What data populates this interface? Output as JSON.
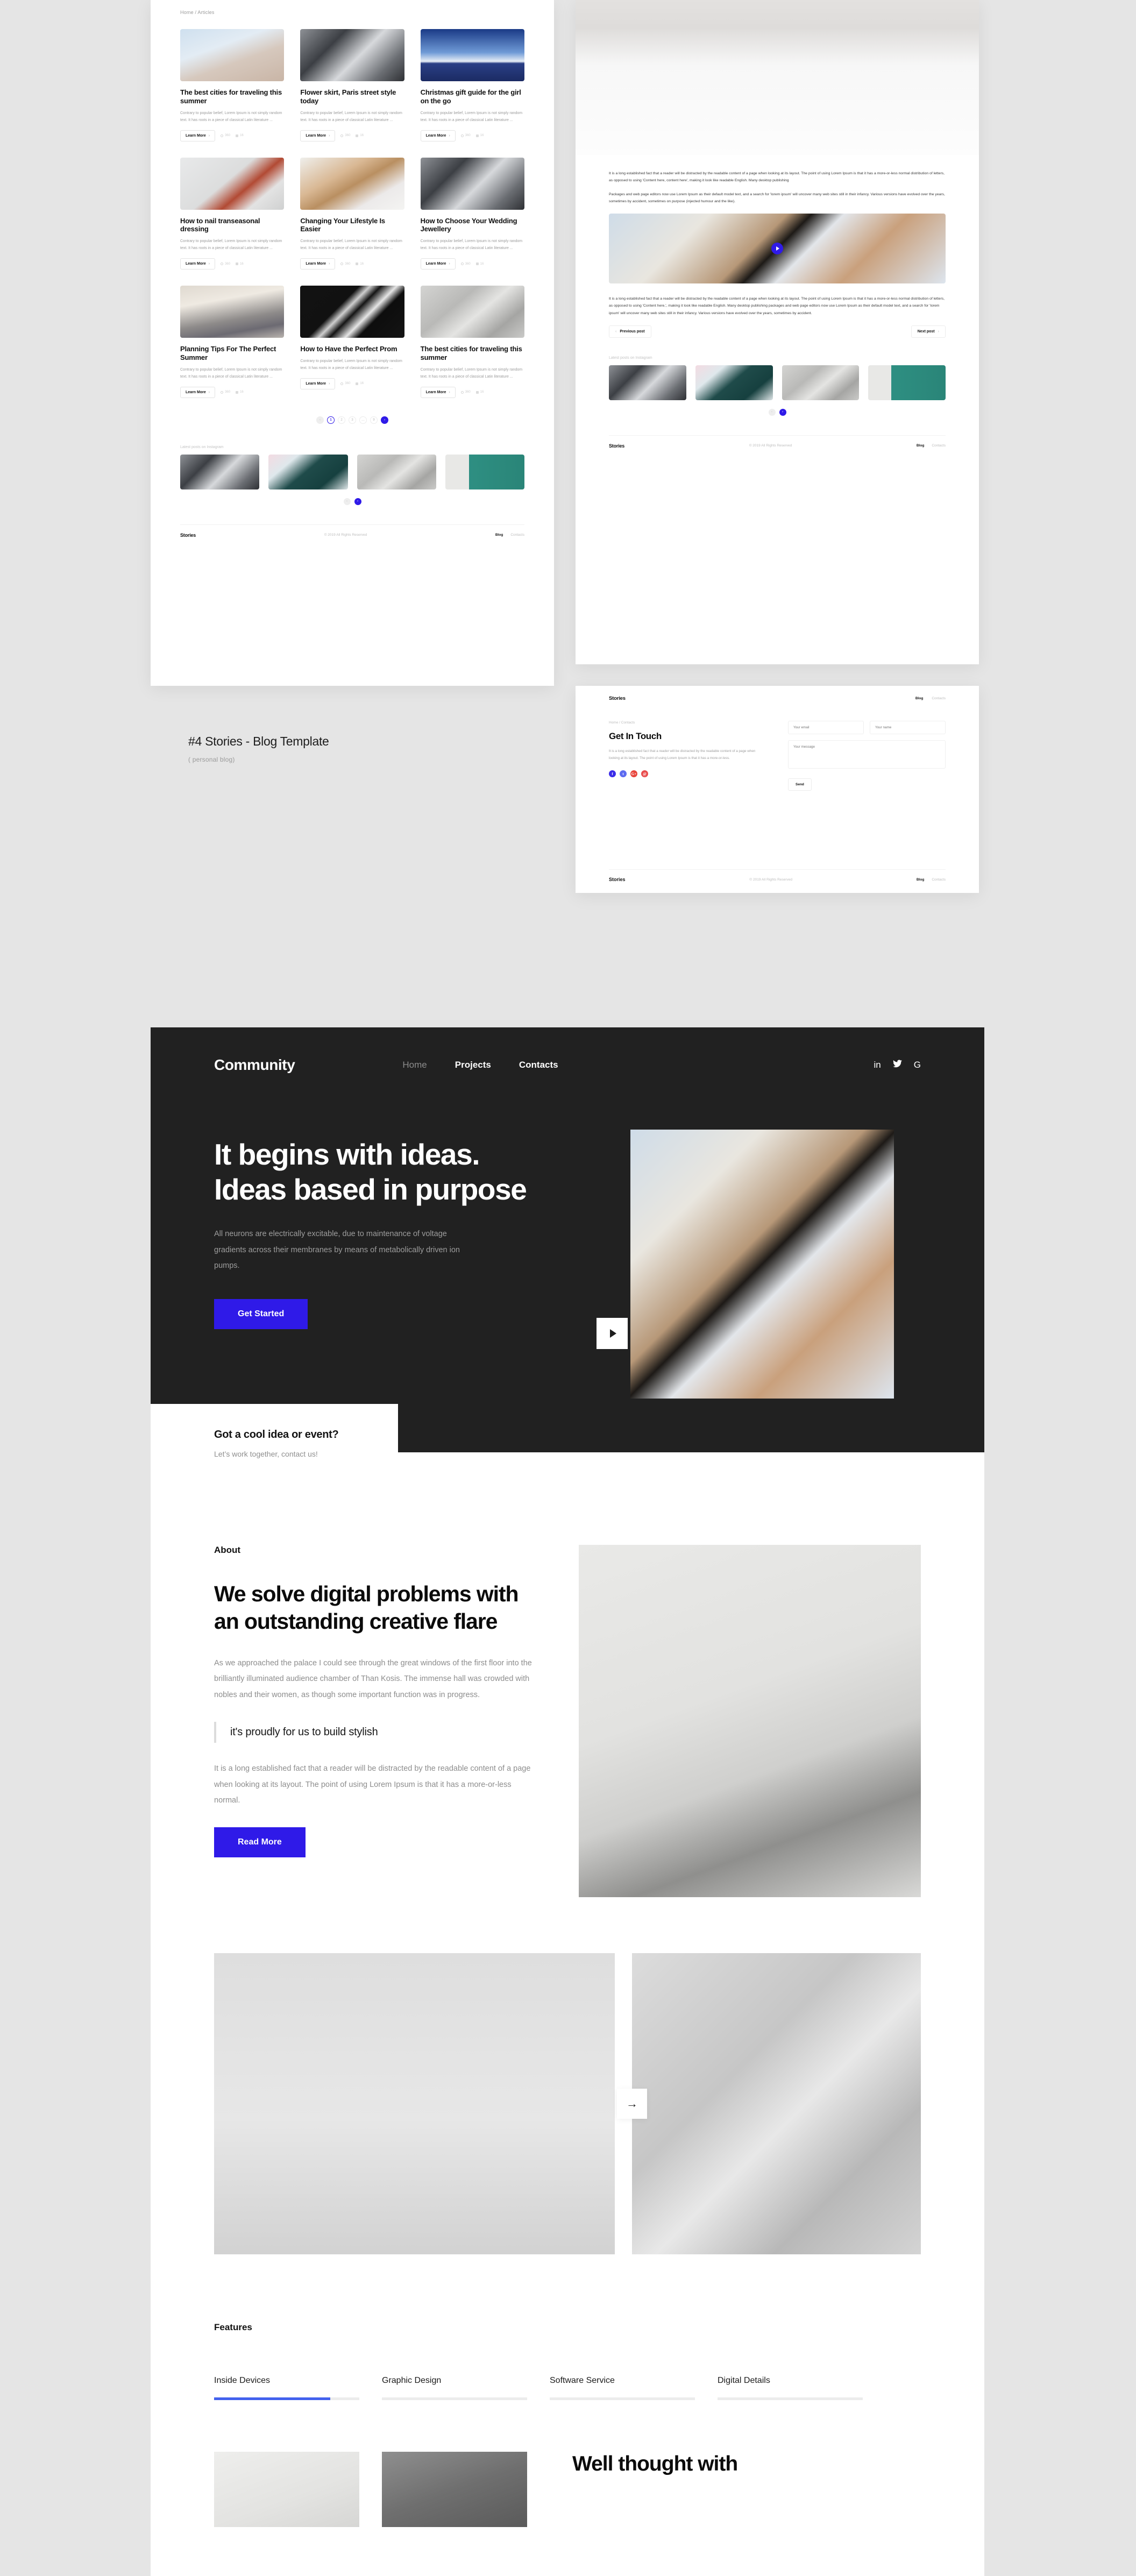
{
  "label": {
    "title": "#4 Stories - Blog Template",
    "subtitle": "( personal blog)"
  },
  "blog_mock": {
    "breadcrumb": "Home / Articles",
    "cards": [
      {
        "title": "The best cities for traveling this summer",
        "desc": "Contrary to popular belief, Lorem Ipsum is not simply random text. It has roots in a piece of classical Latin literature ...",
        "cta": "Learn More",
        "views": "360",
        "comments": "16",
        "image": "ph-sneaker"
      },
      {
        "title": "Flower skirt, Paris street style today",
        "desc": "Contrary to popular belief, Lorem Ipsum is not simply random text. It has roots in a piece of classical Latin literature ...",
        "cta": "Learn More",
        "views": "360",
        "comments": "16",
        "image": "ph-vinyl"
      },
      {
        "title": "Christmas gift guide for the girl on the go",
        "desc": "Contrary to popular belief, Lorem Ipsum is not simply random text. It has roots in a piece of classical Latin literature ...",
        "cta": "Learn More",
        "views": "360",
        "comments": "16",
        "image": "ph-dune"
      },
      {
        "title": "How to nail transeasonal dressing",
        "desc": "Contrary to popular belief, Lorem Ipsum is not simply random text. It has roots in a piece of classical Latin literature ...",
        "cta": "Learn More",
        "views": "360",
        "comments": "16",
        "image": "ph-bridge"
      },
      {
        "title": "Changing Your Lifestyle Is Easier",
        "desc": "Contrary to popular belief, Lorem Ipsum is not simply random text. It has roots in a piece of classical Latin literature ...",
        "cta": "Learn More",
        "views": "360",
        "comments": "16",
        "image": "ph-hair"
      },
      {
        "title": "How to Choose Your Wedding Jewellery",
        "desc": "Contrary to popular belief, Lorem Ipsum is not simply random text. It has roots in a piece of classical Latin literature ...",
        "cta": "Learn More",
        "views": "360",
        "comments": "16",
        "image": "ph-vinyl"
      },
      {
        "title": "Planning Tips For The Perfect Summer",
        "desc": "Contrary to popular belief, Lorem Ipsum is not simply random text. It has roots in a piece of classical Latin literature ...",
        "cta": "Learn More",
        "views": "360",
        "comments": "16",
        "image": "ph-alley"
      },
      {
        "title": "How to Have the Perfect Prom",
        "desc": "Contrary to popular belief, Lorem Ipsum is not simply random text. It has roots in a piece of classical Latin literature ...",
        "cta": "Learn More",
        "views": "360",
        "comments": "16",
        "image": "ph-chevron"
      },
      {
        "title": "The best cities for traveling this summer",
        "desc": "Contrary to popular belief, Lorem Ipsum is not simply random text. It has roots in a piece of classical Latin literature ...",
        "cta": "Learn More",
        "views": "360",
        "comments": "16",
        "image": "ph-fabric"
      }
    ],
    "pagination": {
      "prev": "‹",
      "pages": [
        "1",
        "2",
        "3",
        "…",
        "9"
      ],
      "next": "›",
      "current": "1"
    },
    "instagram": {
      "label": "Latest posts on Instagram",
      "thumbs": [
        "ph-vinyl",
        "ph-roof",
        "ph-fabric",
        "ph-teal"
      ],
      "prev": "‹",
      "next": "›"
    },
    "footer": {
      "brand": "Stories",
      "copyright": "© 2019 All Rights Reserved",
      "link1": "Blog",
      "link2": "Contacts"
    }
  },
  "article_mock": {
    "paragraph1": "It is a long established fact that a reader will be distracted by the readable content of a page when looking at its layout. The point of using Lorem Ipsum is that it has a more-or-less normal distribution of letters, as opposed to using 'Content here, content here', making it look like readable English. Many desktop publishing",
    "paragraph2": "Packages and web page editors now use Lorem Ipsum as their default model text, and a search for 'lorem ipsum' will uncover many web sites still in their infancy. Various versions have evolved over the years, sometimes by accident, sometimes on purpose (injected humour and the like).",
    "paragraph3": "It is a long established fact that a reader will be distracted by the readable content of a page when looking at its layout. The point of using Lorem Ipsum is that it has a more-or-less normal distribution of letters, as opposed to using 'Content here,', making it look like readable English. Many desktop publishing packages and web page editors now use Lorem Ipsum as their default model text, and a search for 'lorem ipsum' will uncover many web sites still in their infancy. Various versions have evolved over the years, sometimes by accident.",
    "prev_post": "Previous post",
    "next_post": "Next post",
    "instagram": {
      "label": "Latest posts on Instagram",
      "thumbs": [
        "ph-vinyl",
        "ph-roof",
        "ph-fabric",
        "ph-teal"
      ],
      "prev": "‹",
      "next": "›"
    },
    "footer": {
      "brand": "Stories",
      "copyright": "© 2019 All Rights Reserved",
      "link1": "Blog",
      "link2": "Contacts"
    }
  },
  "contact_mock": {
    "brand": "Stories",
    "nav": {
      "link1": "Blog",
      "link2": "Contacts"
    },
    "breadcrumb": "Home / Contacts",
    "title": "Get In Touch",
    "description": "It is a long established fact that a reader will be distracted by the readable content of a page when looking at its layout. The point of using Lorem Ipsum is that it has a more-or-less.",
    "social": [
      "f",
      "t",
      "G+",
      "@"
    ],
    "form": {
      "email_placeholder": "Your email",
      "name_placeholder": "Your name",
      "message_placeholder": "Your message",
      "submit": "Send"
    },
    "footer": {
      "brand": "Stories",
      "copyright": "© 2019 All Rights Reserved",
      "link1": "Blog",
      "link2": "Contacts"
    }
  },
  "community": {
    "nav": {
      "brand": "Community",
      "links": [
        {
          "label": "Home",
          "active": false
        },
        {
          "label": "Projects",
          "active": true
        },
        {
          "label": "Contacts",
          "active": true
        }
      ],
      "social": [
        "in",
        "ᵗ",
        "G"
      ]
    },
    "hero": {
      "heading_line1": "It begins with ideas.",
      "heading_line2": "Ideas based in purpose",
      "paragraph": "All neurons are electrically excitable, due to maintenance of voltage gradients across their membranes by means of metabolically driven ion pumps.",
      "cta": "Get Started"
    },
    "idea_card": {
      "title": "Got a cool idea or event?",
      "subtitle": "Let’s work together, contact us!"
    },
    "about": {
      "kicker": "About",
      "heading": "We solve digital problems with an outstanding creative flare",
      "paragraph1": "As we approached the palace I could see through the great windows of the first floor into the brilliantly illuminated audience chamber of Than Kosis. The immense hall was crowded with nobles and their women, as though some important function was in progress.",
      "quote": "it's proudly for us to build stylish",
      "paragraph2": "It is a long established fact that a reader will be distracted by the readable content of a page when looking at its layout. The point of using Lorem Ipsum is that it has a more-or-less normal.",
      "cta": "Read More"
    },
    "gallery": {
      "next_arrow": "→"
    },
    "features": {
      "kicker": "Features",
      "tabs": [
        {
          "label": "Inside Devices",
          "progress": "80%",
          "active": true
        },
        {
          "label": "Graphic Design",
          "progress": "0%",
          "active": false
        },
        {
          "label": "Software Service",
          "progress": "0%",
          "active": false
        },
        {
          "label": "Digital Details",
          "progress": "0%",
          "active": false
        }
      ],
      "heading": "Well thought with"
    }
  },
  "colors": {
    "accent_blue": "#2f1ae8",
    "tab_blue": "#4361ee",
    "dark_bg": "#212121",
    "page_bg": "#e5e5e5"
  }
}
